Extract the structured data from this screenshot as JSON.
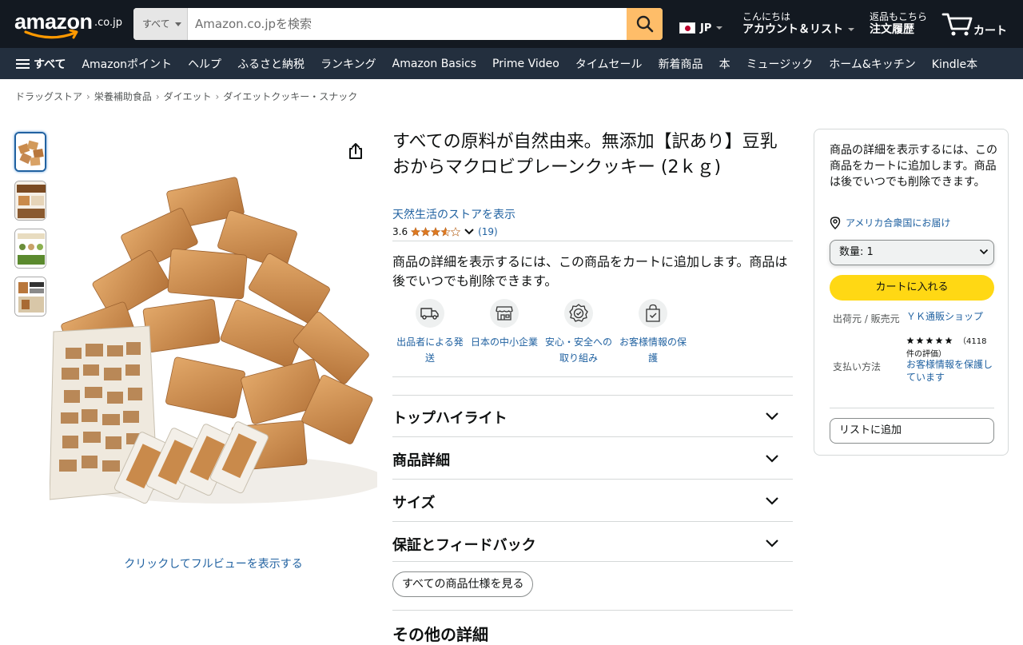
{
  "header": {
    "logo_text": "amazon",
    "logo_tld": ".co.jp",
    "search_category": "すべて",
    "search_placeholder": "Amazon.co.jpを検索",
    "lang_code": "JP",
    "account_line1": "こんにちは",
    "account_line2": "アカウント＆リスト",
    "orders_line1": "返品もこちら",
    "orders_line2": "注文履歴",
    "cart_label": "カート"
  },
  "nav": {
    "all_label": "すべて",
    "links": [
      "Amazonポイント",
      "ヘルプ",
      "ふるさと納税",
      "ランキング",
      "Amazon Basics",
      "Prime Video",
      "タイムセール",
      "新着商品",
      "本",
      "ミュージック",
      "ホーム&キッチン",
      "Kindle本"
    ]
  },
  "breadcrumb": [
    "ドラッグストア",
    "栄養補助食品",
    "ダイエット",
    "ダイエットクッキー・スナック"
  ],
  "gallery": {
    "full_view_label": "クリックしてフルビューを表示する"
  },
  "product": {
    "title": "すべての原料が自然由来。無添加【訳あり】豆乳おからマクロビプレーンクッキー (2ｋｇ)",
    "store_link": "天然生活のストアを表示",
    "rating": "3.6",
    "rating_value": 3.6,
    "review_count": "(19)",
    "cart_notice": "商品の詳細を表示するには、この商品をカートに追加します。商品は後でいつでも削除できます。",
    "features": [
      {
        "icon": "truck-icon",
        "label": "出品者による発送"
      },
      {
        "icon": "storefront-icon",
        "label": "日本の中小企業"
      },
      {
        "icon": "badge-check-icon",
        "label": "安心・安全への取り組み"
      },
      {
        "icon": "secure-bag-icon",
        "label": "お客様情報の保護"
      }
    ],
    "sections": [
      "トップハイライト",
      "商品詳細",
      "サイズ",
      "保証とフィードバック"
    ],
    "all_specs_button": "すべての商品仕様を見る",
    "more_details_title": "その他の詳細"
  },
  "buybox": {
    "notice": "商品の詳細を表示するには、この商品をカートに追加します。商品は後でいつでも削除できます。",
    "deliver_to": "アメリカ合衆国にお届け",
    "quantity": "数量: 1",
    "add_to_cart": "カートに入れる",
    "seller_label": "出荷元 / 販売元",
    "seller_name": "ＹＫ通販ショップ",
    "seller_rating_count": "（4118",
    "seller_rating_suffix": "件の評価）",
    "payment_label": "支払い方法",
    "payment_value": "お客様情報を保護しています",
    "add_to_list": "リストに追加"
  },
  "colors": {
    "header_bg": "#131921",
    "nav_bg": "#232f3e",
    "accent_orange": "#febd69",
    "cart_yellow": "#ffd814",
    "link_blue": "#2162a1",
    "star_orange": "#de7921"
  }
}
